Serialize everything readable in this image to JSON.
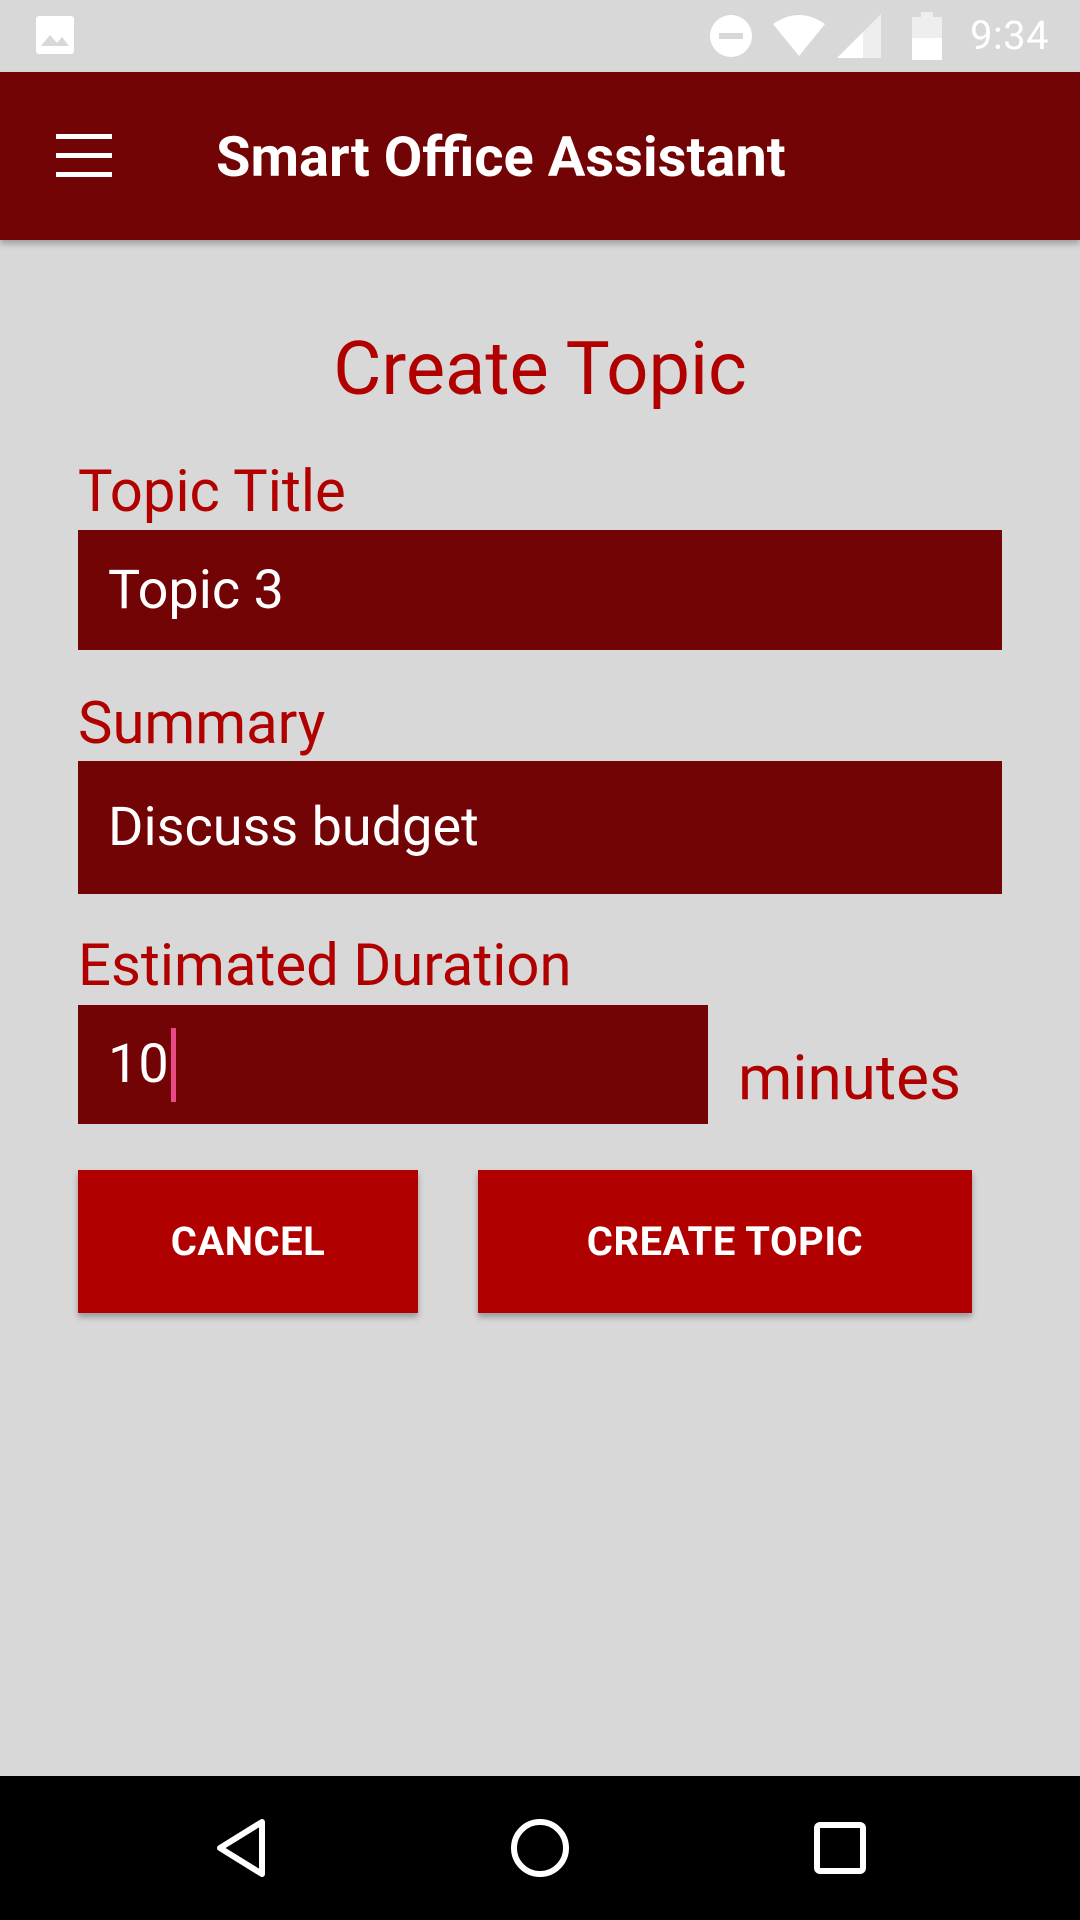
{
  "status_bar": {
    "time": "9:34",
    "icons": [
      "gallery-icon",
      "do-not-disturb-icon",
      "wifi-icon",
      "signal-icon",
      "battery-icon"
    ]
  },
  "app_bar": {
    "title": "Smart Office Assistant",
    "menu_icon": "hamburger-menu-icon"
  },
  "form": {
    "heading": "Create Topic",
    "topic_title": {
      "label": "Topic Title",
      "value": "Topic 3"
    },
    "summary": {
      "label": "Summary",
      "value": "Discuss budget"
    },
    "duration": {
      "label": "Estimated Duration",
      "value": "10",
      "unit": "minutes"
    }
  },
  "buttons": {
    "cancel": "CANCEL",
    "create": "CREATE TOPIC"
  },
  "nav_bar": {
    "icons": [
      "back-icon",
      "home-icon",
      "recents-icon"
    ]
  },
  "colors": {
    "app_bar": "#730406",
    "field_bg": "#730406",
    "accent_text": "#b00000",
    "button": "#b00000",
    "background": "#d8d8d8",
    "cursor": "#e84b86"
  }
}
